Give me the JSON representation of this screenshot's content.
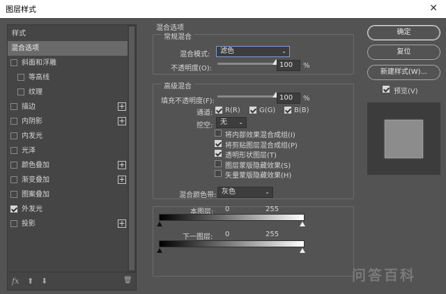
{
  "window": {
    "title": "图层样式",
    "close_glyph": "✕"
  },
  "styles_list": {
    "header": "样式",
    "items": [
      {
        "label": "混合选项",
        "checkbox": false,
        "checked": false,
        "plus": false,
        "selected": true,
        "indent": 0
      },
      {
        "label": "斜面和浮雕",
        "checkbox": true,
        "checked": false,
        "plus": false,
        "selected": false,
        "indent": 0
      },
      {
        "label": "等高线",
        "checkbox": true,
        "checked": false,
        "plus": false,
        "selected": false,
        "indent": 1
      },
      {
        "label": "纹理",
        "checkbox": true,
        "checked": false,
        "plus": false,
        "selected": false,
        "indent": 1
      },
      {
        "label": "描边",
        "checkbox": true,
        "checked": false,
        "plus": true,
        "selected": false,
        "indent": 0
      },
      {
        "label": "内阴影",
        "checkbox": true,
        "checked": false,
        "plus": true,
        "selected": false,
        "indent": 0
      },
      {
        "label": "内发光",
        "checkbox": true,
        "checked": false,
        "plus": false,
        "selected": false,
        "indent": 0
      },
      {
        "label": "光泽",
        "checkbox": true,
        "checked": false,
        "plus": false,
        "selected": false,
        "indent": 0
      },
      {
        "label": "颜色叠加",
        "checkbox": true,
        "checked": false,
        "plus": true,
        "selected": false,
        "indent": 0
      },
      {
        "label": "渐变叠加",
        "checkbox": true,
        "checked": false,
        "plus": true,
        "selected": false,
        "indent": 0
      },
      {
        "label": "图案叠加",
        "checkbox": true,
        "checked": false,
        "plus": false,
        "selected": false,
        "indent": 0
      },
      {
        "label": "外发光",
        "checkbox": true,
        "checked": true,
        "plus": false,
        "selected": false,
        "indent": 0
      },
      {
        "label": "投影",
        "checkbox": true,
        "checked": false,
        "plus": true,
        "selected": false,
        "indent": 0
      }
    ],
    "footer": {
      "fx": "fx",
      "up": "⬆",
      "down": "⬇",
      "trash": "🗑"
    }
  },
  "blend_options": {
    "title": "混合选项",
    "general": {
      "title": "常规混合",
      "mode_label": "混合模式:",
      "mode_value": "滤色",
      "opacity_label": "不透明度(O):",
      "opacity_value": "100",
      "opacity_unit": "%",
      "opacity_fraction": 1.0
    },
    "advanced": {
      "title": "高级混合",
      "fill_label": "填充不透明度(F):",
      "fill_value": "100",
      "fill_unit": "%",
      "fill_fraction": 1.0,
      "channels_label": "通道:",
      "channel_r": "R(R)",
      "channel_g": "G(G)",
      "channel_b": "B(B)",
      "knockout_label": "挖空:",
      "knockout_value": "无",
      "options": [
        {
          "label": "将内部效果混合成组(I)",
          "checked": false
        },
        {
          "label": "将剪贴图层混合成组(P)",
          "checked": true
        },
        {
          "label": "透明形状图层(T)",
          "checked": true
        },
        {
          "label": "图层蒙版隐藏效果(S)",
          "checked": false
        },
        {
          "label": "矢量蒙版隐藏效果(H)",
          "checked": false
        }
      ]
    },
    "blend_if": {
      "label": "混合颜色带:",
      "value": "灰色",
      "this_layer_label": "本图层:",
      "this_min": "0",
      "this_max": "255",
      "underlying_label": "下一图层:",
      "under_min": "0",
      "under_max": "255"
    }
  },
  "buttons": {
    "ok": "确定",
    "reset": "复位",
    "new_style": "新建样式(W)...",
    "preview_label": "预览(V)",
    "preview_checked": true
  },
  "watermark": "问答百科",
  "dropdown_arrow": "⌄"
}
